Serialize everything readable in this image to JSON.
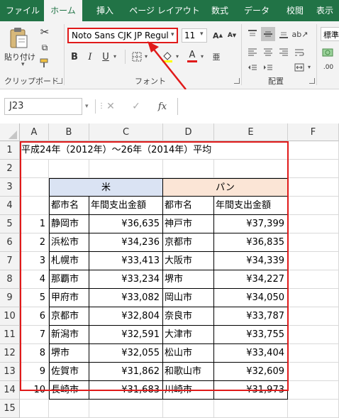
{
  "ribbon": {
    "tabs": [
      "ファイル",
      "ホーム",
      "挿入",
      "ページ レイアウト",
      "数式",
      "データ",
      "校閲",
      "表示"
    ],
    "active_tab": "ホーム",
    "clipboard": {
      "paste_label": "貼り付け",
      "group_label": "クリップボード"
    },
    "font": {
      "name_value": "Noto Sans CJK JP Regul",
      "size_value": "11",
      "group_label": "フォント",
      "bold": "B",
      "italic": "I",
      "underline": "U",
      "font_color_letter": "A"
    },
    "alignment": {
      "group_label": "配置"
    },
    "number": {
      "format_value": "標準"
    },
    "colors": {
      "accent": "#217346",
      "highlight": "#e01a1a"
    }
  },
  "formula_bar": {
    "name_box": "J23",
    "fx": "fx",
    "formula": ""
  },
  "sheet": {
    "columns": [
      "A",
      "B",
      "C",
      "D",
      "E",
      "F"
    ],
    "rows": [
      "1",
      "2",
      "3",
      "4",
      "5",
      "6",
      "7",
      "8",
      "9",
      "10",
      "11",
      "12",
      "13",
      "14",
      "15"
    ],
    "title": "平成24年（2012年）～26年（2014年）平均",
    "group_rice": "米",
    "group_bread": "パン",
    "header_city": "都市名",
    "header_spending": "年間支出金額",
    "header_city_2": "都市名",
    "header_spending_2": "年間支出金額",
    "ranks": [
      "1",
      "2",
      "3",
      "4",
      "5",
      "6",
      "7",
      "8",
      "9",
      "10"
    ],
    "rice_cities": [
      "静岡市",
      "浜松市",
      "札幌市",
      "那覇市",
      "甲府市",
      "京都市",
      "新潟市",
      "堺市",
      "佐賀市",
      "長崎市"
    ],
    "rice_values": [
      "¥36,635",
      "¥34,236",
      "¥33,413",
      "¥33,234",
      "¥33,082",
      "¥32,804",
      "¥32,591",
      "¥32,055",
      "¥31,862",
      "¥31,683"
    ],
    "bread_cities": [
      "神戸市",
      "京都市",
      "大阪市",
      "堺市",
      "岡山市",
      "奈良市",
      "大津市",
      "松山市",
      "和歌山市",
      "川崎市"
    ],
    "bread_values": [
      "¥37,399",
      "¥36,835",
      "¥34,339",
      "¥34,227",
      "¥34,050",
      "¥33,787",
      "¥33,755",
      "¥33,404",
      "¥32,609",
      "¥31,973"
    ],
    "rice_fill": "#dae3f3",
    "bread_fill": "#fbe5d6"
  }
}
